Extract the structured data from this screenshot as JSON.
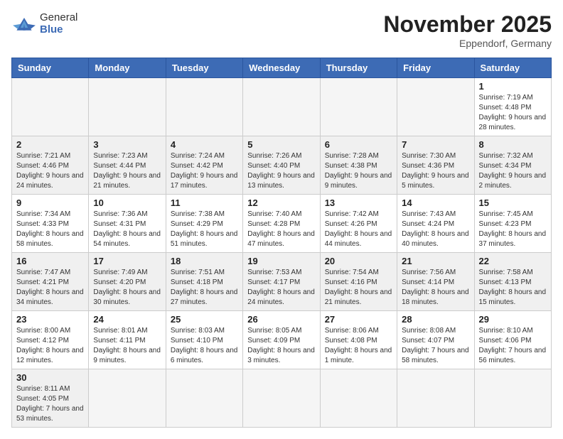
{
  "header": {
    "logo_general": "General",
    "logo_blue": "Blue",
    "month_title": "November 2025",
    "location": "Eppendorf, Germany"
  },
  "days_of_week": [
    "Sunday",
    "Monday",
    "Tuesday",
    "Wednesday",
    "Thursday",
    "Friday",
    "Saturday"
  ],
  "weeks": [
    [
      {
        "day": "",
        "info": ""
      },
      {
        "day": "",
        "info": ""
      },
      {
        "day": "",
        "info": ""
      },
      {
        "day": "",
        "info": ""
      },
      {
        "day": "",
        "info": ""
      },
      {
        "day": "",
        "info": ""
      },
      {
        "day": "1",
        "info": "Sunrise: 7:19 AM\nSunset: 4:48 PM\nDaylight: 9 hours and 28 minutes."
      }
    ],
    [
      {
        "day": "2",
        "info": "Sunrise: 7:21 AM\nSunset: 4:46 PM\nDaylight: 9 hours and 24 minutes."
      },
      {
        "day": "3",
        "info": "Sunrise: 7:23 AM\nSunset: 4:44 PM\nDaylight: 9 hours and 21 minutes."
      },
      {
        "day": "4",
        "info": "Sunrise: 7:24 AM\nSunset: 4:42 PM\nDaylight: 9 hours and 17 minutes."
      },
      {
        "day": "5",
        "info": "Sunrise: 7:26 AM\nSunset: 4:40 PM\nDaylight: 9 hours and 13 minutes."
      },
      {
        "day": "6",
        "info": "Sunrise: 7:28 AM\nSunset: 4:38 PM\nDaylight: 9 hours and 9 minutes."
      },
      {
        "day": "7",
        "info": "Sunrise: 7:30 AM\nSunset: 4:36 PM\nDaylight: 9 hours and 5 minutes."
      },
      {
        "day": "8",
        "info": "Sunrise: 7:32 AM\nSunset: 4:34 PM\nDaylight: 9 hours and 2 minutes."
      }
    ],
    [
      {
        "day": "9",
        "info": "Sunrise: 7:34 AM\nSunset: 4:33 PM\nDaylight: 8 hours and 58 minutes."
      },
      {
        "day": "10",
        "info": "Sunrise: 7:36 AM\nSunset: 4:31 PM\nDaylight: 8 hours and 54 minutes."
      },
      {
        "day": "11",
        "info": "Sunrise: 7:38 AM\nSunset: 4:29 PM\nDaylight: 8 hours and 51 minutes."
      },
      {
        "day": "12",
        "info": "Sunrise: 7:40 AM\nSunset: 4:28 PM\nDaylight: 8 hours and 47 minutes."
      },
      {
        "day": "13",
        "info": "Sunrise: 7:42 AM\nSunset: 4:26 PM\nDaylight: 8 hours and 44 minutes."
      },
      {
        "day": "14",
        "info": "Sunrise: 7:43 AM\nSunset: 4:24 PM\nDaylight: 8 hours and 40 minutes."
      },
      {
        "day": "15",
        "info": "Sunrise: 7:45 AM\nSunset: 4:23 PM\nDaylight: 8 hours and 37 minutes."
      }
    ],
    [
      {
        "day": "16",
        "info": "Sunrise: 7:47 AM\nSunset: 4:21 PM\nDaylight: 8 hours and 34 minutes."
      },
      {
        "day": "17",
        "info": "Sunrise: 7:49 AM\nSunset: 4:20 PM\nDaylight: 8 hours and 30 minutes."
      },
      {
        "day": "18",
        "info": "Sunrise: 7:51 AM\nSunset: 4:18 PM\nDaylight: 8 hours and 27 minutes."
      },
      {
        "day": "19",
        "info": "Sunrise: 7:53 AM\nSunset: 4:17 PM\nDaylight: 8 hours and 24 minutes."
      },
      {
        "day": "20",
        "info": "Sunrise: 7:54 AM\nSunset: 4:16 PM\nDaylight: 8 hours and 21 minutes."
      },
      {
        "day": "21",
        "info": "Sunrise: 7:56 AM\nSunset: 4:14 PM\nDaylight: 8 hours and 18 minutes."
      },
      {
        "day": "22",
        "info": "Sunrise: 7:58 AM\nSunset: 4:13 PM\nDaylight: 8 hours and 15 minutes."
      }
    ],
    [
      {
        "day": "23",
        "info": "Sunrise: 8:00 AM\nSunset: 4:12 PM\nDaylight: 8 hours and 12 minutes."
      },
      {
        "day": "24",
        "info": "Sunrise: 8:01 AM\nSunset: 4:11 PM\nDaylight: 8 hours and 9 minutes."
      },
      {
        "day": "25",
        "info": "Sunrise: 8:03 AM\nSunset: 4:10 PM\nDaylight: 8 hours and 6 minutes."
      },
      {
        "day": "26",
        "info": "Sunrise: 8:05 AM\nSunset: 4:09 PM\nDaylight: 8 hours and 3 minutes."
      },
      {
        "day": "27",
        "info": "Sunrise: 8:06 AM\nSunset: 4:08 PM\nDaylight: 8 hours and 1 minute."
      },
      {
        "day": "28",
        "info": "Sunrise: 8:08 AM\nSunset: 4:07 PM\nDaylight: 7 hours and 58 minutes."
      },
      {
        "day": "29",
        "info": "Sunrise: 8:10 AM\nSunset: 4:06 PM\nDaylight: 7 hours and 56 minutes."
      }
    ],
    [
      {
        "day": "30",
        "info": "Sunrise: 8:11 AM\nSunset: 4:05 PM\nDaylight: 7 hours and 53 minutes."
      },
      {
        "day": "",
        "info": ""
      },
      {
        "day": "",
        "info": ""
      },
      {
        "day": "",
        "info": ""
      },
      {
        "day": "",
        "info": ""
      },
      {
        "day": "",
        "info": ""
      },
      {
        "day": "",
        "info": ""
      }
    ]
  ]
}
